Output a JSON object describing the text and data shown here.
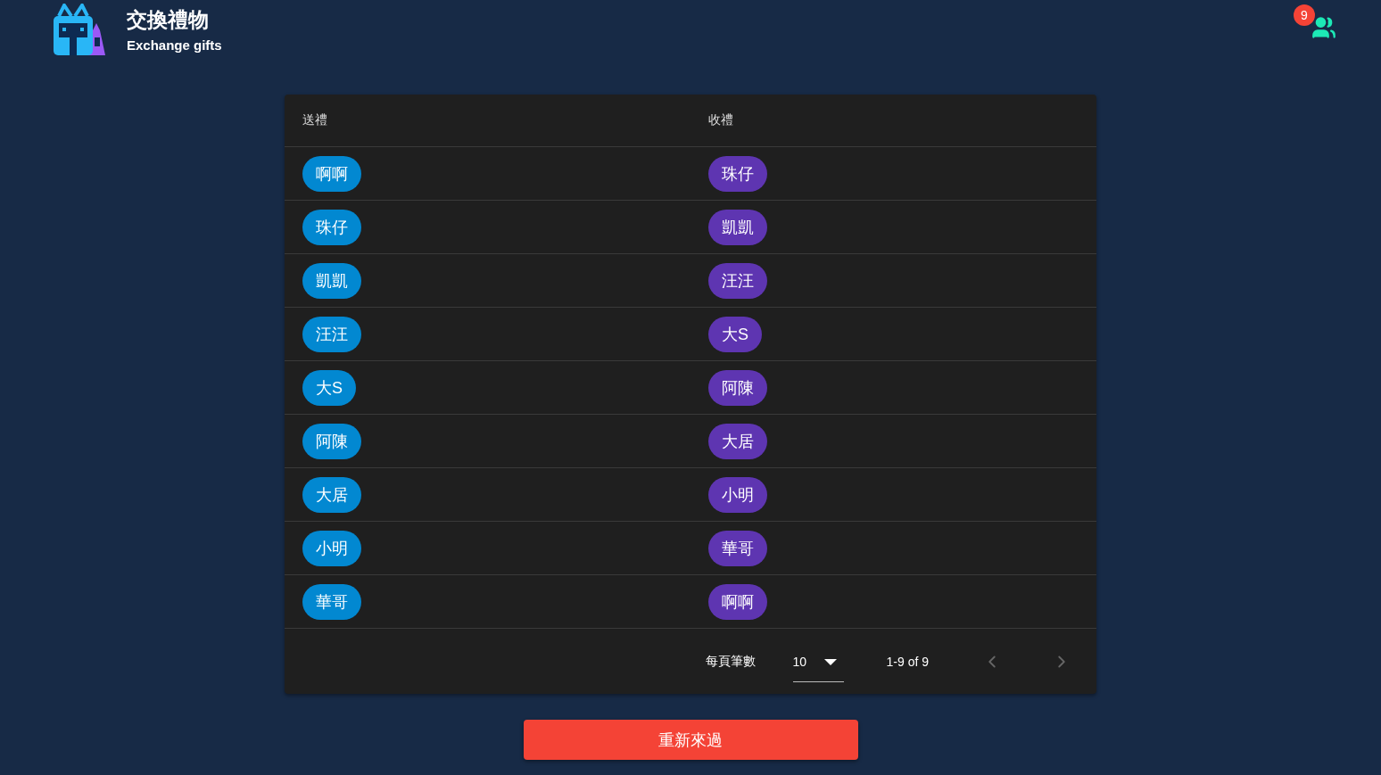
{
  "header": {
    "title": "交換禮物",
    "subtitle": "Exchange gifts",
    "badge": "9"
  },
  "table": {
    "columns": [
      "送禮",
      "收禮"
    ],
    "rows": [
      {
        "giver": "啊啊",
        "receiver": "珠仔"
      },
      {
        "giver": "珠仔",
        "receiver": "凱凱"
      },
      {
        "giver": "凱凱",
        "receiver": "汪汪"
      },
      {
        "giver": "汪汪",
        "receiver": "大S"
      },
      {
        "giver": "大S",
        "receiver": "阿陳"
      },
      {
        "giver": "阿陳",
        "receiver": "大居"
      },
      {
        "giver": "大居",
        "receiver": "小明"
      },
      {
        "giver": "小明",
        "receiver": "華哥"
      },
      {
        "giver": "華哥",
        "receiver": "啊啊"
      }
    ],
    "pagination": {
      "rows_per_page_label": "每頁筆數",
      "rows_per_page": "10",
      "range": "1-9 of 9",
      "prev_disabled": true,
      "next_disabled": true
    }
  },
  "reset_button": "重新來過"
}
